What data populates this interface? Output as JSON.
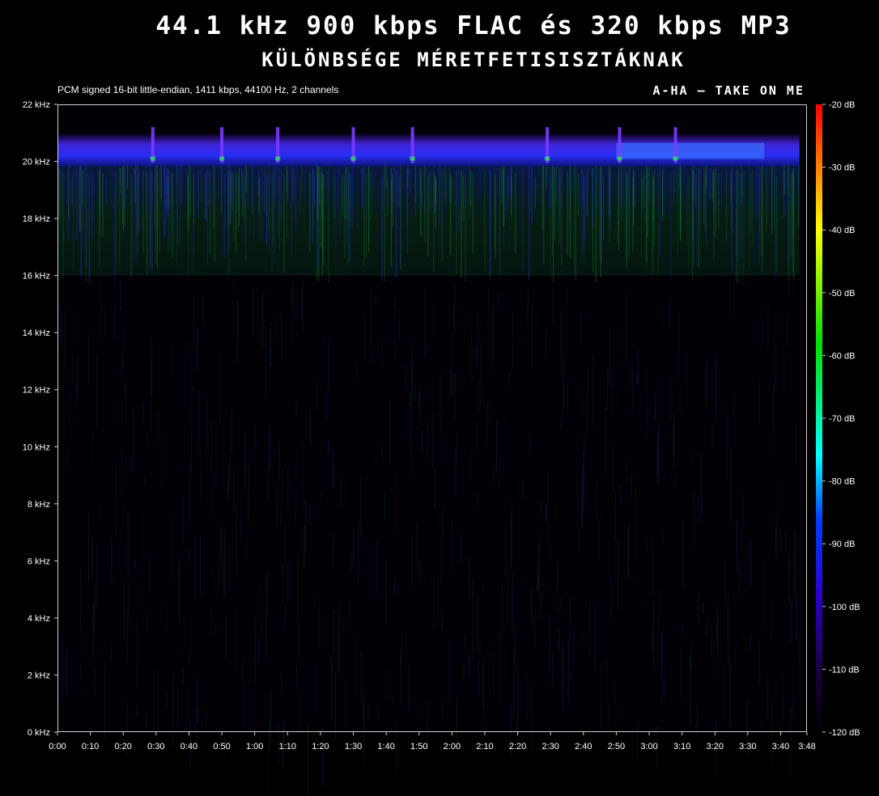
{
  "header": {
    "title": "44.1 kHz 900 kbps FLAC és 320 kbps MP3",
    "subtitle": "KÜLÖNBSÉGE MÉRETFETISISZTÁKNAK",
    "info": "PCM signed 16-bit little-endian, 1411 kbps, 44100 Hz, 2 channels",
    "song": "A-HA – TAKE ON ME"
  },
  "chart_data": {
    "type": "heatmap",
    "title": "44.1 kHz 900 kbps FLAC és 320 kbps MP3",
    "xlabel": "",
    "ylabel": "",
    "x_ticks": [
      "0:00",
      "0:10",
      "0:20",
      "0:30",
      "0:40",
      "0:50",
      "1:00",
      "1:10",
      "1:20",
      "1:30",
      "1:40",
      "1:50",
      "2:00",
      "2:10",
      "2:20",
      "2:30",
      "2:40",
      "2:50",
      "3:00",
      "3:10",
      "3:20",
      "3:30",
      "3:40",
      "3:48"
    ],
    "x_tick_seconds": [
      0,
      10,
      20,
      30,
      40,
      50,
      60,
      70,
      80,
      90,
      100,
      110,
      120,
      130,
      140,
      150,
      160,
      170,
      180,
      190,
      200,
      210,
      220,
      228
    ],
    "xlim_seconds": [
      0,
      228
    ],
    "y_ticks": [
      "0 kHz",
      "2 kHz",
      "4 kHz",
      "6 kHz",
      "8 kHz",
      "10 kHz",
      "12 kHz",
      "14 kHz",
      "16 kHz",
      "18 kHz",
      "20 kHz",
      "22 kHz"
    ],
    "y_tick_khz": [
      0,
      2,
      4,
      6,
      8,
      10,
      12,
      14,
      16,
      18,
      20,
      22
    ],
    "ylim_khz": [
      0,
      22
    ],
    "colorbar": {
      "labels": [
        "-20 dB",
        "-30 dB",
        "-40 dB",
        "-50 dB",
        "-60 dB",
        "-70 dB",
        "-80 dB",
        "-90 dB",
        "-100 dB",
        "-110 dB",
        "-120 dB"
      ],
      "values_db": [
        -20,
        -30,
        -40,
        -50,
        -60,
        -70,
        -80,
        -90,
        -100,
        -110,
        -120
      ],
      "range_db": [
        -120,
        -20
      ],
      "colors": [
        "#ff0000",
        "#ff8000",
        "#ffff00",
        "#00e000",
        "#00ffff",
        "#0040ff",
        "#2a00d0",
        "#1a0040",
        "#000000"
      ]
    },
    "features": {
      "lowpass_cutoff_khz": 16,
      "strong_band_khz": [
        20,
        20.6
      ],
      "transient_peaks_seconds": [
        29,
        50,
        67,
        90,
        108,
        149,
        171,
        188
      ]
    }
  }
}
